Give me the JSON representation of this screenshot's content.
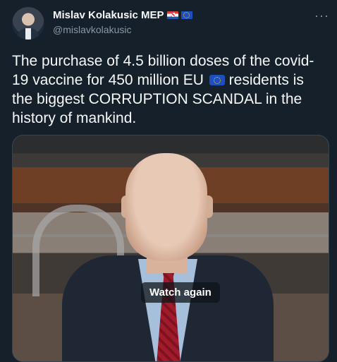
{
  "author": {
    "display_name": "Mislav Kolakusic MEP",
    "handle": "@mislavkolakusic",
    "flags": [
      "croatia-flag-icon",
      "eu-flag-icon"
    ]
  },
  "tweet": {
    "text_before_flag": "The purchase of 4.5 billion doses of the covid-19 vaccine for 450 million EU",
    "text_after_flag": "residents is the biggest CORRUPTION SCANDAL in the history of mankind."
  },
  "media": {
    "overlay_label": "Watch again"
  },
  "menu_icon": "more-icon",
  "colors": {
    "background": "#15202b",
    "text": "#f7f9f9",
    "secondary_text": "#8b98a5",
    "eu_blue": "#1d4fbf"
  }
}
